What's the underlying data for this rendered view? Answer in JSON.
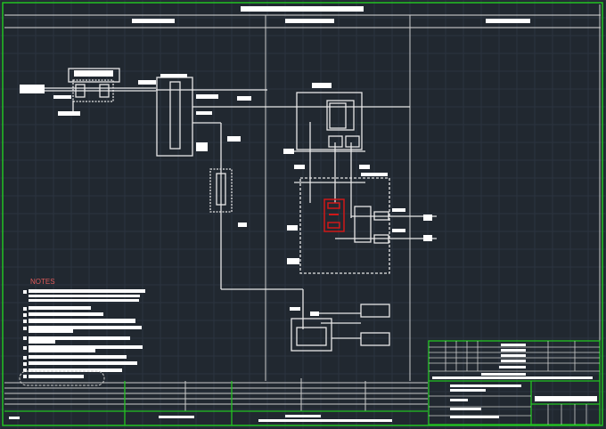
{
  "drawing": {
    "notes_title": "NOTES",
    "colors": {
      "background": "#212830",
      "frame": "#22c322",
      "lines": "#e8e8e8",
      "highlight": "#d01818",
      "notes_title": "#e05a5a"
    }
  }
}
